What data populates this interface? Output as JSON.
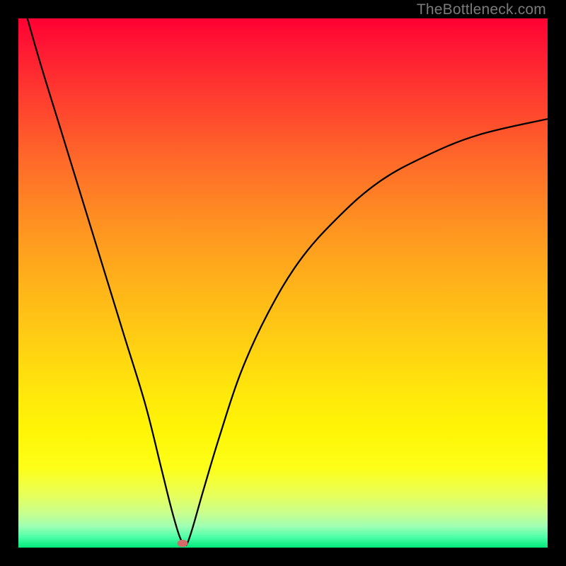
{
  "watermark": "TheBottleneck.com",
  "colors": {
    "frame": "#000000",
    "curve": "#000000",
    "bump": "#d46a6a"
  },
  "chart_data": {
    "type": "line",
    "title": "",
    "xlabel": "",
    "ylabel": "",
    "xlim": [
      0,
      100
    ],
    "ylim": [
      0,
      100
    ],
    "grid": false,
    "legend": false,
    "background": "gradient red→orange→yellow→green (top→bottom)",
    "series": [
      {
        "name": "bottleneck-curve",
        "x": [
          0,
          4,
          8,
          12,
          16,
          20,
          24,
          27,
          29,
          30.5,
          31.5,
          32,
          33,
          35,
          38,
          42,
          47,
          53,
          60,
          68,
          77,
          87,
          100
        ],
        "y": [
          106,
          92,
          79,
          66,
          53,
          40,
          27,
          15,
          7,
          2,
          0.5,
          1,
          4,
          11,
          21,
          33,
          44,
          54,
          62,
          69,
          74,
          78,
          81
        ]
      }
    ],
    "marker": {
      "name": "minimum-point",
      "x": 31,
      "y": 0.8
    }
  }
}
